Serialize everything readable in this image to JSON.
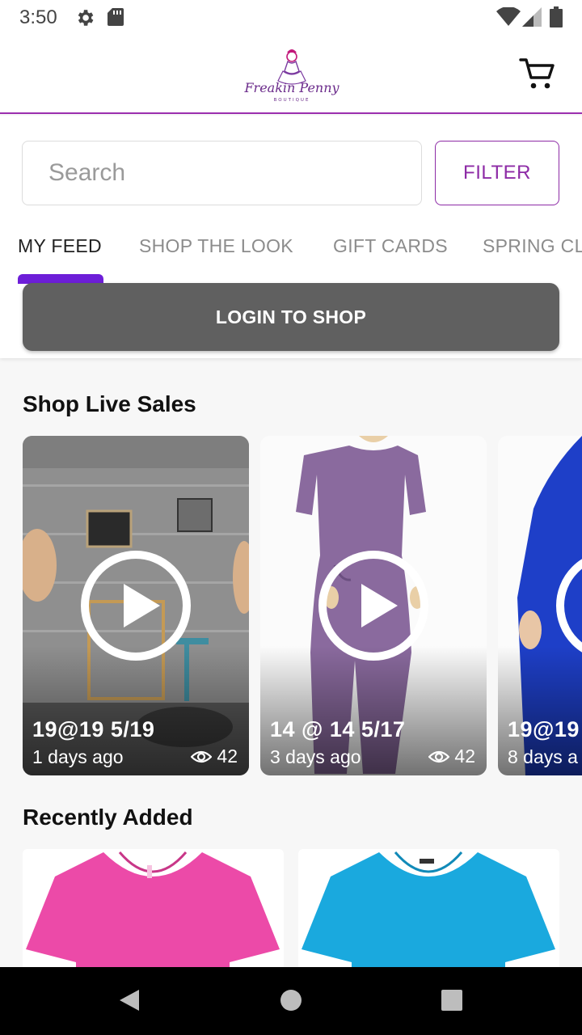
{
  "status_bar": {
    "time": "3:50",
    "icons": [
      "gear-icon",
      "sd-card-icon",
      "wifi-icon",
      "signal-icon",
      "battery-icon"
    ]
  },
  "header": {
    "logo_text": "Freakin Penny",
    "logo_subtext": "BOUTIQUE",
    "cart_icon": "cart-icon"
  },
  "search": {
    "placeholder": "Search",
    "filter_label": "FILTER"
  },
  "tabs": [
    {
      "label": "MY FEED",
      "active": true
    },
    {
      "label": "SHOP THE LOOK",
      "active": false
    },
    {
      "label": "GIFT CARDS",
      "active": false
    },
    {
      "label": "SPRING CL",
      "active": false
    }
  ],
  "login_button": "LOGIN TO SHOP",
  "live_sales": {
    "title": "Shop Live Sales",
    "items": [
      {
        "title": "19@19 5/19",
        "age": "1 days ago",
        "views": "42"
      },
      {
        "title": "14 @ 14 5/17",
        "age": "3 days ago",
        "views": "42"
      },
      {
        "title": "19@19",
        "age": "8 days a",
        "views": ""
      }
    ]
  },
  "recently_added": {
    "title": "Recently Added",
    "items": [
      {
        "name": "pink-tshirt"
      },
      {
        "name": "turquoise-tshirt"
      }
    ]
  },
  "colors": {
    "accent": "#8d2ba6",
    "tab_indicator": "#6d1ed8",
    "login_bg": "#606060"
  }
}
